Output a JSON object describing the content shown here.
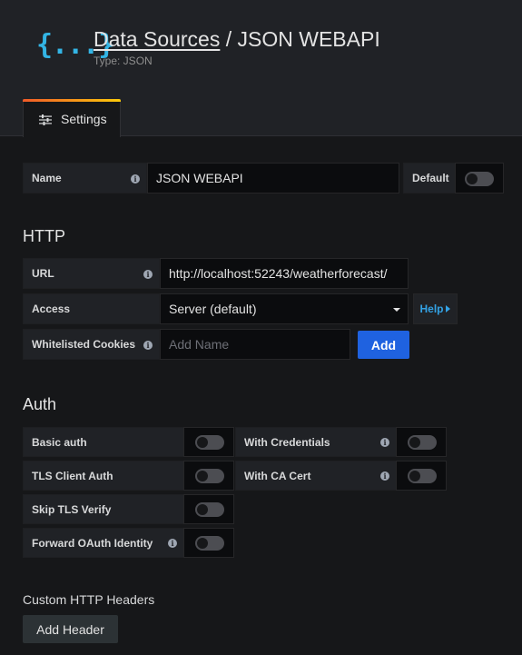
{
  "header": {
    "logo_text": "{...}",
    "breadcrumb_link": "Data Sources",
    "separator": " / ",
    "title": "JSON WEBAPI",
    "subtitle": "Type: JSON"
  },
  "tabs": [
    {
      "label": "Settings",
      "icon": "sliders-icon",
      "active": true
    }
  ],
  "name_row": {
    "label": "Name",
    "value": "JSON WEBAPI",
    "default_label": "Default",
    "default_on": false
  },
  "http": {
    "title": "HTTP",
    "url_label": "URL",
    "url_value": "http://localhost:52243/weatherforecast/",
    "access_label": "Access",
    "access_value": "Server (default)",
    "help_label": "Help",
    "cookies_label": "Whitelisted Cookies",
    "cookies_placeholder": "Add Name",
    "add_label": "Add"
  },
  "auth": {
    "title": "Auth",
    "basic_auth": "Basic auth",
    "with_credentials": "With Credentials",
    "tls_client_auth": "TLS Client Auth",
    "with_ca_cert": "With CA Cert",
    "skip_tls_verify": "Skip TLS Verify",
    "forward_oauth": "Forward OAuth Identity"
  },
  "custom_headers": {
    "title": "Custom HTTP Headers",
    "add_header_label": "Add Header"
  },
  "colors": {
    "accent_blue": "#33b5e5",
    "primary_button": "#1f62e0",
    "tab_gradient_start": "#f05a28",
    "tab_gradient_end": "#fbca0a"
  }
}
